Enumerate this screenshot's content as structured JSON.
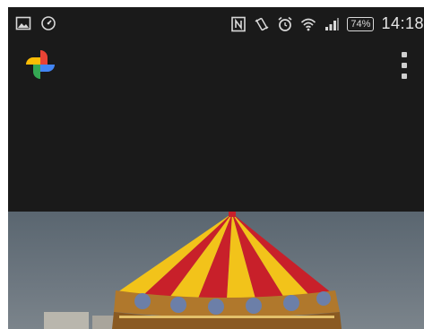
{
  "status_bar": {
    "left_icons": [
      "gallery-icon",
      "sync-icon"
    ],
    "right_icons": [
      "nfc-icon",
      "vibrate-icon",
      "alarm-icon",
      "wifi-icon",
      "signal-icon"
    ],
    "battery": "74%",
    "time": "14:18"
  },
  "app_bar": {
    "logo": "google-photos-pinwheel-icon",
    "menu": "more-vert-icon"
  },
  "photo": {
    "subject": "carousel-image"
  },
  "colors": {
    "background": "#1a1a1a",
    "carousel_red": "#c8202a",
    "carousel_yellow": "#f2c31a"
  }
}
